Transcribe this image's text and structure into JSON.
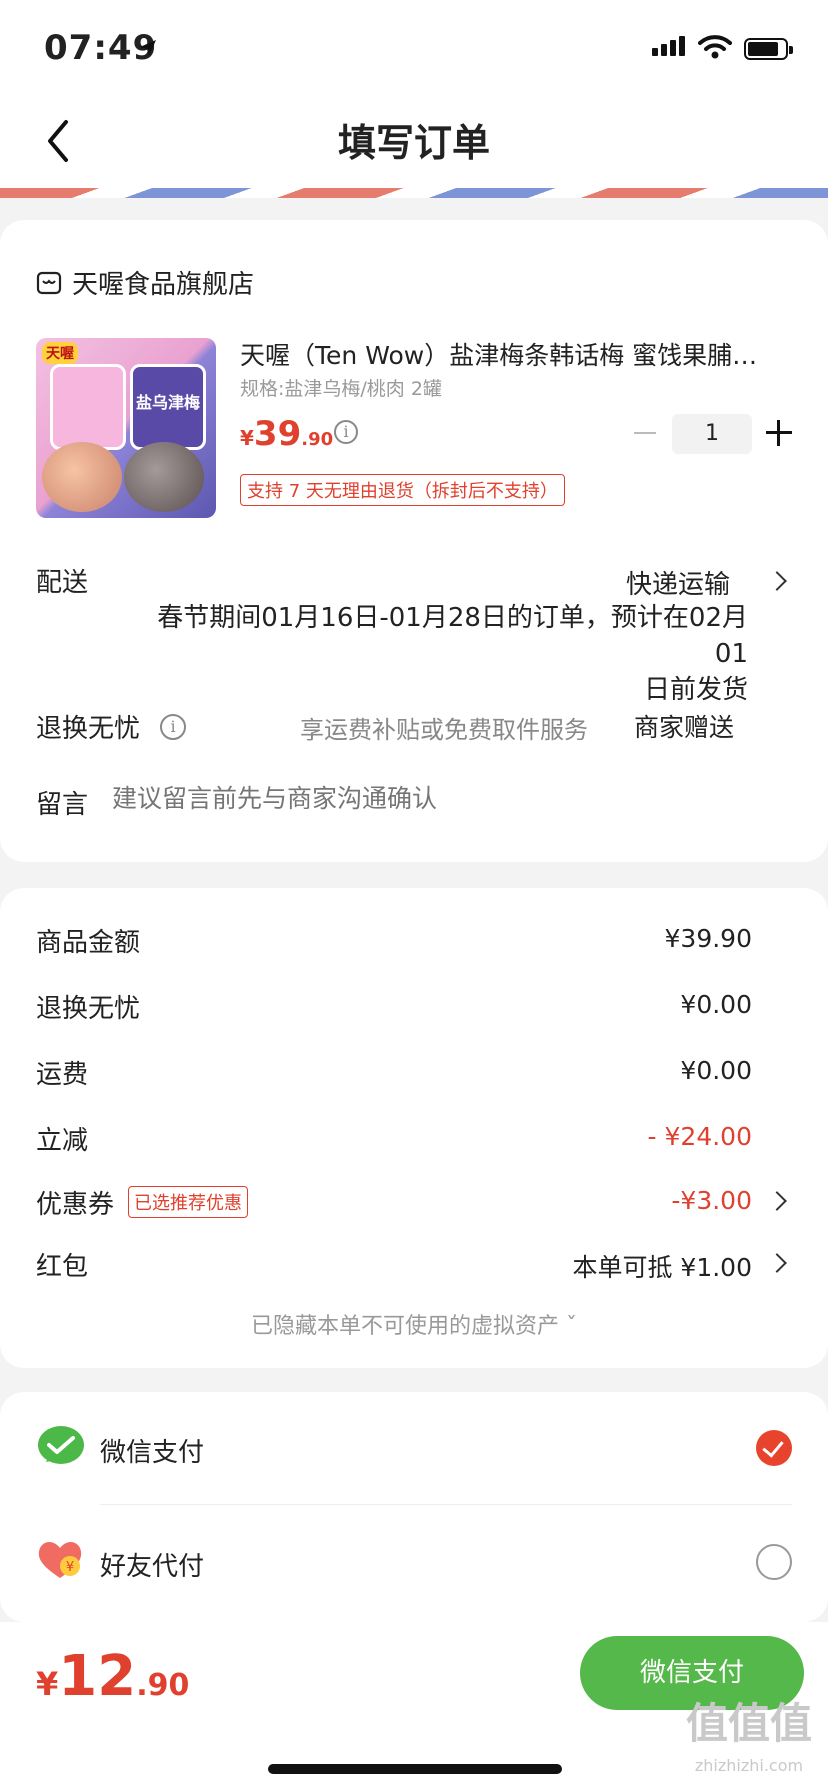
{
  "status_bar": {
    "time": "07:49"
  },
  "nav": {
    "title": "填写订单"
  },
  "store": {
    "name": "天喔食品旗舰店"
  },
  "product": {
    "title": "天喔（Ten Wow）盐津梅条韩话梅  蜜饯果脯…",
    "spec": "规格:盐津乌梅/桃肉 2罐",
    "price_currency": "¥",
    "price_int": "39",
    "price_dec": ".90",
    "quantity": "1",
    "return_tag": "支持 7 天无理由退货（拆封后不支持）",
    "image_text": {
      "brand": "天喔",
      "jar2": "盐乌津梅"
    }
  },
  "delivery": {
    "label": "配送",
    "value": "快递运输",
    "note_line1": "春节期间01月16日-01月28日的订单，预计在02月01",
    "note_line2": "日前发货"
  },
  "returns": {
    "label": "退换无忧",
    "desc": "享运费补贴或免费取件服务",
    "value": "商家赠送"
  },
  "message": {
    "label": "留言",
    "placeholder": "建议留言前先与商家沟通确认"
  },
  "summary": {
    "goods_label": "商品金额",
    "goods_value": "¥39.90",
    "returns_label": "退换无忧",
    "returns_value": "¥0.00",
    "shipping_label": "运费",
    "shipping_value": "¥0.00",
    "discount_label": "立减",
    "discount_value": "- ¥24.00",
    "coupon_label": "优惠券",
    "coupon_tag": "已选推荐优惠",
    "coupon_value": "-¥3.00",
    "redpacket_label": "红包",
    "redpacket_value": "本单可抵 ¥1.00",
    "hidden_assets": "已隐藏本单不可使用的虚拟资产 ˇ"
  },
  "payment": {
    "wechat_label": "微信支付",
    "friend_label": "好友代付",
    "selected": "微信支付",
    "accent": "#e8432c"
  },
  "bottom": {
    "total_currency": "¥",
    "total_int": "12",
    "total_dec": ".90",
    "pay_button": "微信支付",
    "button_color": "#55b84a"
  },
  "watermark": {
    "main": "值值值",
    "sub": "zhizhizhi.com"
  }
}
